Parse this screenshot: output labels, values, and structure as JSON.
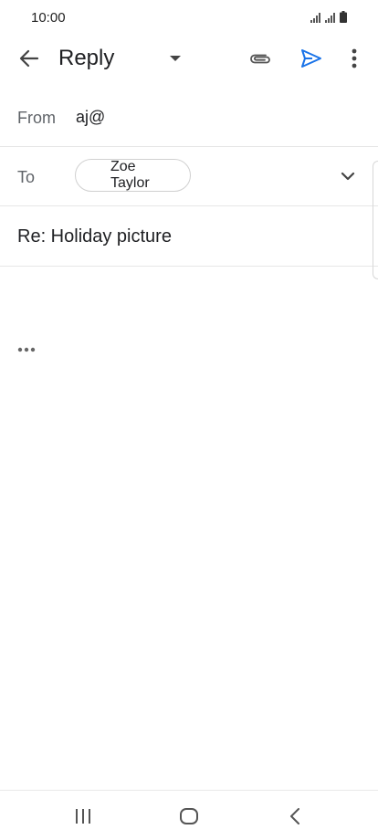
{
  "status_bar": {
    "time": "10:00"
  },
  "app_bar": {
    "title": "Reply",
    "icons": [
      "arrow-back-icon",
      "dropdown-arrow-icon",
      "attachment-icon",
      "send-icon",
      "more-vert-icon"
    ]
  },
  "compose": {
    "from_label": "From",
    "from_value": "aj@",
    "to_label": "To",
    "recipients": [
      "Zoe Taylor"
    ],
    "subject": "Re: Holiday picture",
    "body": ""
  },
  "colors": {
    "accent": "#1a73e8",
    "icon_gray": "#5f6368",
    "text": "#202124",
    "divider": "#e6e6e6"
  },
  "nav_bar": {
    "icons": [
      "recents-icon",
      "home-icon",
      "nav-back-icon"
    ]
  }
}
